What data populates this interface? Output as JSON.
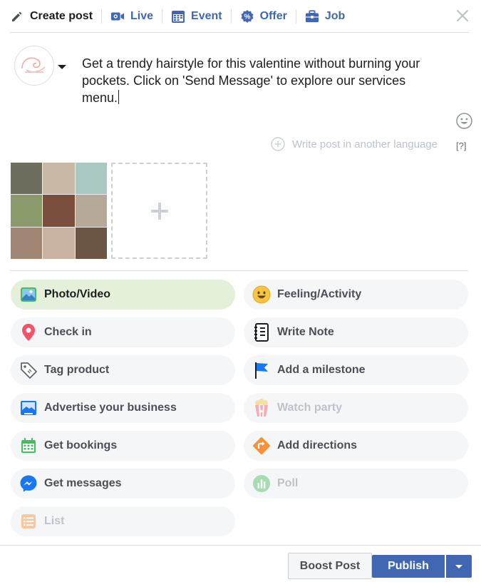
{
  "tabs": {
    "create_post": "Create post",
    "live": "Live",
    "event": "Event",
    "offer": "Offer",
    "job": "Job"
  },
  "composer": {
    "text": "Get a trendy hairstyle for this valentine without burning your pockets. Click on 'Send Message' to explore our services menu.",
    "write_in_language": "Write post in another language",
    "help": "[?]"
  },
  "actions": {
    "photo_video": "Photo/Video",
    "feeling_activity": "Feeling/Activity",
    "check_in": "Check in",
    "write_note": "Write Note",
    "tag_product": "Tag product",
    "add_milestone": "Add a milestone",
    "advertise": "Advertise your business",
    "watch_party": "Watch party",
    "get_bookings": "Get bookings",
    "add_directions": "Add directions",
    "get_messages": "Get messages",
    "poll": "Poll",
    "list": "List"
  },
  "footer": {
    "boost_label": "Boost Post",
    "publish_label": "Publish"
  },
  "colors": {
    "brand_blue": "#4267b2",
    "active_green_bg": "#e4f0d9",
    "pill_bg": "#f5f6f7",
    "disabled_text": "#bec3c9"
  }
}
